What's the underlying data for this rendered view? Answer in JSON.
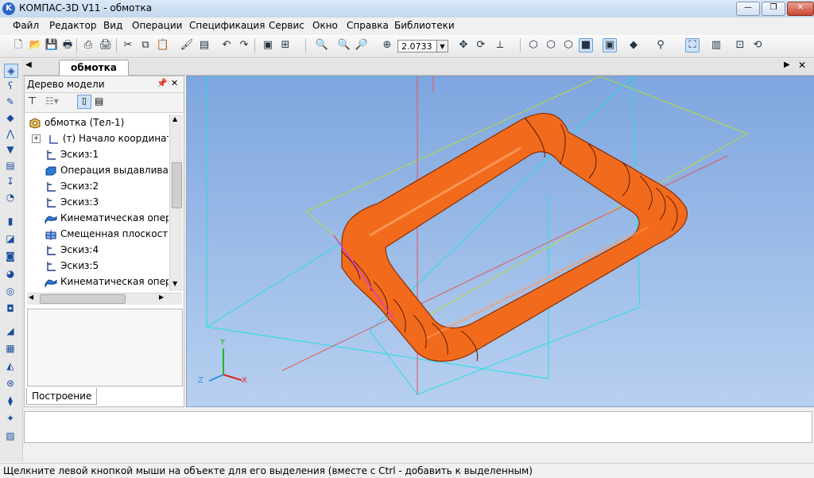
{
  "window": {
    "title": "КОМПАС-3D V11 - обмотка",
    "app_icon": "kompas-logo"
  },
  "menu": [
    "Файл",
    "Редактор",
    "Вид",
    "Операции",
    "Спецификация",
    "Сервис",
    "Окно",
    "Справка",
    "Библиотеки"
  ],
  "toolbar": {
    "zoom_value": "2.0733"
  },
  "document": {
    "tab_label": "обмотка"
  },
  "tree_panel": {
    "title": "Дерево модели",
    "items": [
      {
        "label": "обмотка (Тел-1)",
        "icon": "part-icon"
      },
      {
        "label": "(т) Начало координат",
        "icon": "origin-icon"
      },
      {
        "label": "Эскиз:1",
        "icon": "sketch-icon"
      },
      {
        "label": "Операция выдавливания",
        "icon": "extrude-icon"
      },
      {
        "label": "Эскиз:2",
        "icon": "sketch-icon"
      },
      {
        "label": "Эскиз:3",
        "icon": "sketch-icon"
      },
      {
        "label": "Кинематическая операция",
        "icon": "sweep-icon"
      },
      {
        "label": "Смещенная плоскость",
        "icon": "plane-icon"
      },
      {
        "label": "Эскиз:4",
        "icon": "sketch-icon"
      },
      {
        "label": "Эскиз:5",
        "icon": "sketch-icon"
      },
      {
        "label": "Кинематическая операция",
        "icon": "sweep-icon"
      }
    ],
    "bottom_tab": "Построение"
  },
  "axes": {
    "y": "Y",
    "z": "Z",
    "x": "X"
  },
  "status_text": "Щелкните левой кнопкой мыши на объекте для его выделения (вместе с Ctrl - добавить к выделенным)",
  "colors": {
    "model": "#f26b1d",
    "viewport_top": "#7ea6df",
    "viewport_bottom": "#b8d0f0"
  }
}
